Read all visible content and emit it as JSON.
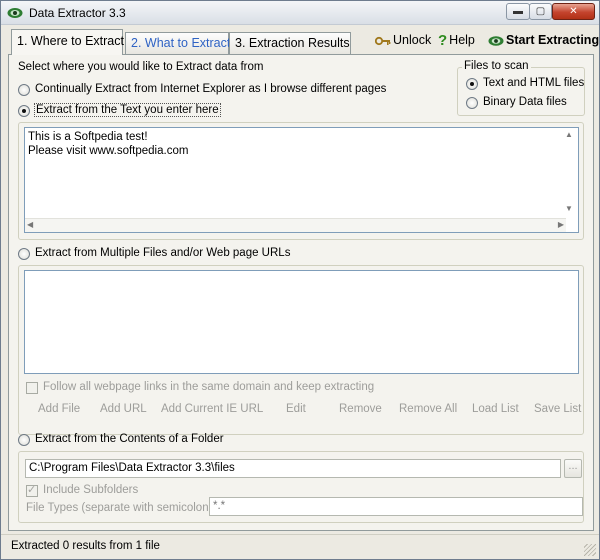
{
  "window": {
    "title": "Data Extractor 3.3",
    "min_glyph": "▬",
    "max_glyph": "▢",
    "close_glyph": "✕"
  },
  "tabs": [
    {
      "label": "1. Where to Extract",
      "active": true
    },
    {
      "label": "2. What to Extract",
      "active": false
    },
    {
      "label": "3. Extraction Results",
      "active": false
    }
  ],
  "toolbar": {
    "unlock_label": "Unlock",
    "help_label": "Help",
    "start_label": "Start Extracting"
  },
  "where": {
    "prompt": "Select where you would like to Extract data from",
    "opt_ie_label": "Continually Extract from Internet Explorer as I browse different pages",
    "opt_text_label": "Extract from the Text you enter here",
    "text_content": "This is a Softpedia test!\nPlease visit www.softpedia.com",
    "opt_files_label": "Extract from Multiple Files and/or Web page URLs",
    "follow_links_label": "Follow all webpage links in the same domain and keep extracting",
    "url_actions": [
      "Add File",
      "Add URL",
      "Add Current IE URL",
      "Edit",
      "Remove",
      "Remove All",
      "Load List",
      "Save List"
    ],
    "opt_folder_label": "Extract from the Contents of a Folder",
    "folder_path": "C:\\Program Files\\Data Extractor 3.3\\files",
    "browse_label": "...",
    "include_subfolders_label": "Include Subfolders",
    "file_types_label": "File Types (separate with semicolons)",
    "file_types_value": "*.*"
  },
  "files_to_scan": {
    "title": "Files to scan",
    "opt_text_html": "Text and HTML files",
    "opt_binary": "Binary Data files"
  },
  "status": {
    "text": "Extracted 0 results from 1 file"
  },
  "colors": {
    "accent_link": "#2f63c4",
    "close_button": "#c4442e",
    "disabled_text": "#9d9d9a"
  }
}
